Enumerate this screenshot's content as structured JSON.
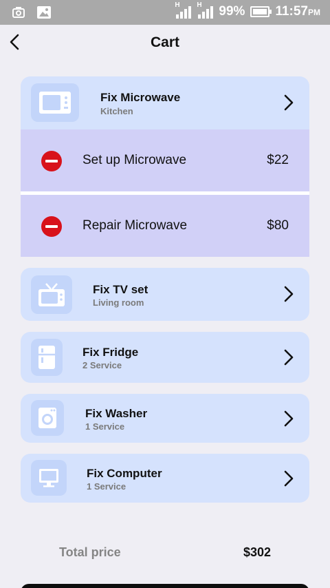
{
  "status_bar": {
    "battery_percent": "99%",
    "time": "11:57",
    "time_suffix": "PM",
    "network_1": "H",
    "network_2": "H"
  },
  "header": {
    "title": "Cart"
  },
  "categories": [
    {
      "title": "Fix Microwave",
      "subtitle": "Kitchen",
      "icon": "microwave-icon",
      "expanded": true
    },
    {
      "title": "Fix TV set",
      "subtitle": "Living room",
      "icon": "tv-icon"
    },
    {
      "title": "Fix Fridge",
      "subtitle": "2 Service",
      "icon": "fridge-icon"
    },
    {
      "title": "Fix Washer",
      "subtitle": "1 Service",
      "icon": "washer-icon"
    },
    {
      "title": "Fix Computer",
      "subtitle": "1 Service",
      "icon": "computer-icon"
    }
  ],
  "services": [
    {
      "name": "Set up Microwave",
      "price": "$22"
    },
    {
      "name": "Repair Microwave",
      "price": "$80"
    }
  ],
  "total": {
    "label": "Total price",
    "value": "$302"
  },
  "colors": {
    "card": "#d5e2fd",
    "icon_bg": "#c3d5fa",
    "service_row": "#d1d0f7",
    "remove": "#d8121b",
    "background": "#efeef4"
  }
}
